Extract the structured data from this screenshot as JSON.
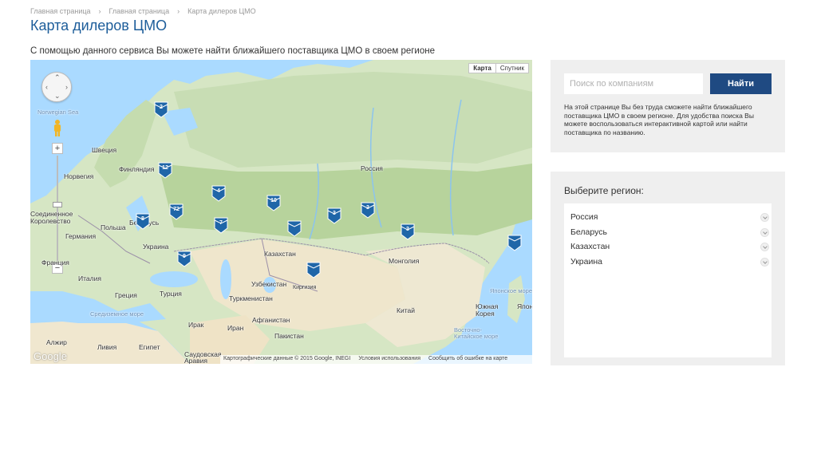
{
  "breadcrumb": {
    "items": [
      "Главная страница",
      "Главная страница",
      "Карта дилеров ЦМО"
    ]
  },
  "page": {
    "title": "Карта дилеров ЦМО",
    "subtitle": "С помощью данного сервиса Вы можете найти ближайшего поставщика ЦМО в своем регионе"
  },
  "map": {
    "type_buttons": [
      "Карта",
      "Спутник"
    ],
    "active_type": "Карта",
    "labels": {
      "norwegian_sea": "Norwegian Sea",
      "sweden": "Швеция",
      "finland": "Финляндия",
      "norway": "Норвегия",
      "russia": "Россия",
      "uk": "Соединенное Королевство",
      "poland": "Польша",
      "belarus": "Беларусь",
      "germany": "Германия",
      "ukraine": "Украина",
      "france": "Франция",
      "italy": "Италия",
      "kazakhstan": "Казахстан",
      "mongolia": "Монголия",
      "uzbekistan": "Узбекистан",
      "kyrgyzstan": "Киргизия",
      "greece": "Греция",
      "turkey": "Турция",
      "turkmenistan": "Туркменистан",
      "mediterranean": "Средиземное море",
      "iraq": "Ирак",
      "iran": "Иран",
      "afghanistan": "Афганистан",
      "pakistan": "Пакистан",
      "china": "Китай",
      "south_korea": "Южная Корея",
      "japan": "Япония",
      "sea_of_japan": "Японское море",
      "east_china_sea": "Восточно-Китайское море",
      "algeria": "Алжир",
      "libya": "Ливия",
      "egypt": "Египет",
      "saudi": "Саудовская Аравия"
    },
    "markers": [
      {
        "id": "m1",
        "count": "2"
      },
      {
        "id": "m2",
        "count": "12"
      },
      {
        "id": "m3",
        "count": "4"
      },
      {
        "id": "m4",
        "count": "10"
      },
      {
        "id": "m5",
        "count": "72"
      },
      {
        "id": "m6",
        "count": "8"
      },
      {
        "id": "m7",
        "count": "7"
      },
      {
        "id": "m8",
        "count": ""
      },
      {
        "id": "m9",
        "count": "3"
      },
      {
        "id": "m10",
        "count": "3"
      },
      {
        "id": "m11",
        "count": "3"
      },
      {
        "id": "m12",
        "count": "9"
      },
      {
        "id": "m13",
        "count": ""
      },
      {
        "id": "m14",
        "count": ""
      }
    ],
    "google_logo": "Google",
    "attribution": "Картографические данные © 2015 Google, INEGI",
    "terms": "Условия использования",
    "report": "Сообщить об ошибке на карте",
    "colors": {
      "water": "#aadaff",
      "land": "#e8e4d8",
      "forest": "#b5d29a",
      "desert": "#f2ead2",
      "marker": "#1f66a8",
      "border": "#9b8fa8"
    }
  },
  "search": {
    "placeholder": "Поиск по компаниям",
    "button_label": "Найти",
    "help_text": "На этой странице Вы без труда сможете найти ближайшего поставщика ЦМО в своем регионе. Для удобства поиска Вы можете воспользоваться интерактивной картой или найти поставщика по названию."
  },
  "regions": {
    "title": "Выберите регион:",
    "items": [
      "Россия",
      "Беларусь",
      "Казахстан",
      "Украина"
    ]
  },
  "colors": {
    "title": "#1d5d9a",
    "button": "#1f4a82",
    "panel": "#efefef"
  }
}
